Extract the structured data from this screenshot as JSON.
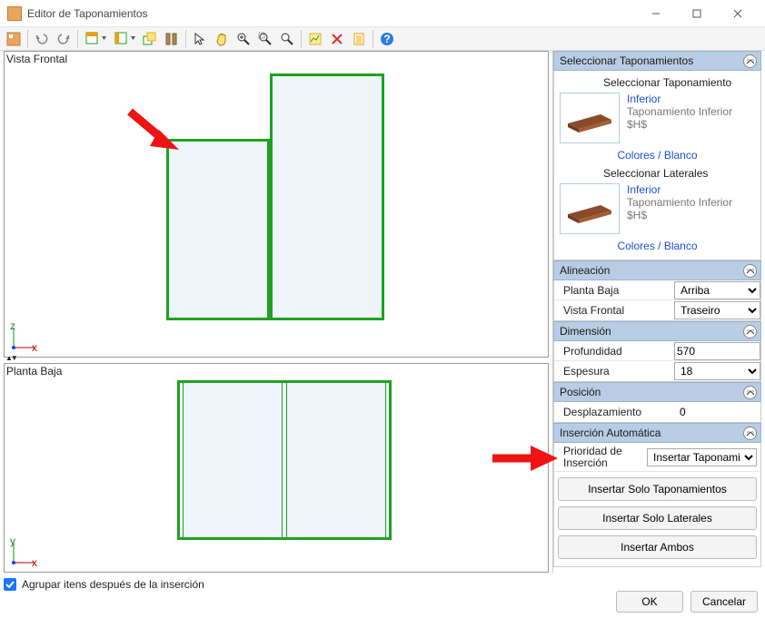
{
  "window": {
    "title": "Editor de Taponamientos"
  },
  "views": {
    "front": "Vista Frontal",
    "plan": "Planta Baja"
  },
  "checkbox": {
    "group_after_insert": "Agrupar itens después de la inserción"
  },
  "buttons": {
    "ok": "OK",
    "cancel": "Cancelar"
  },
  "panel": {
    "select_hdr": "Seleccionar Taponamientos",
    "select_tap_title": "Seleccionar Taponamiento",
    "select_lat_title": "Seleccionar Laterales",
    "thumb_link": "Inferior",
    "thumb_sub": "Taponamiento Inferior $H$",
    "colors_link": "Colores / Blanco",
    "align_hdr": "Alineación",
    "align_plan_label": "Planta Baja",
    "align_plan_value": "Arriba",
    "align_front_label": "Vista Frontal",
    "align_front_value": "Traseiro",
    "dim_hdr": "Dimensión",
    "depth_label": "Profundidad",
    "depth_value": "570",
    "thick_label": "Espesura",
    "thick_value": "18",
    "pos_hdr": "Posición",
    "offset_label": "Desplazamiento",
    "offset_value": "0",
    "ins_hdr": "Inserción Automática",
    "priority_label_l1": "Prioridad de",
    "priority_label_l2": "Inserción",
    "priority_value": "Insertar Taponamient",
    "btn_only_tap": "Insertar Solo Taponamientos",
    "btn_only_lat": "Insertar Solo Laterales",
    "btn_both": "Insertar Ambos"
  }
}
